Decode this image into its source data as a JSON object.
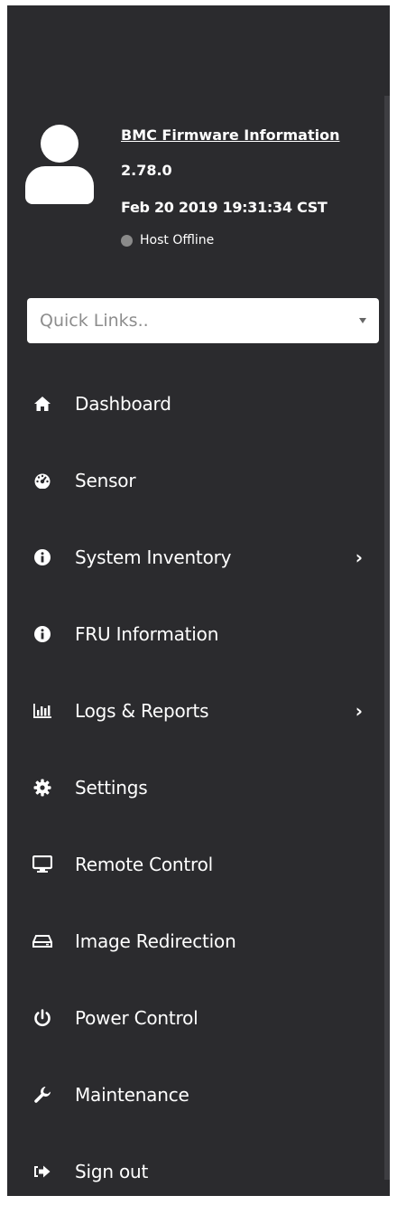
{
  "profile": {
    "firmware_link": "BMC Firmware Information",
    "version": "2.78.0",
    "build_date": "Feb 20 2019 19:31:34 CST",
    "host_status": "Host Offline",
    "host_status_color": "#8a8a8a"
  },
  "quick_links": {
    "placeholder": "Quick Links.."
  },
  "nav": {
    "items": [
      {
        "label": "Dashboard",
        "icon": "home-icon"
      },
      {
        "label": "Sensor",
        "icon": "gauge-icon"
      },
      {
        "label": "System Inventory",
        "icon": "info-icon",
        "has_submenu": true
      },
      {
        "label": "FRU Information",
        "icon": "info-icon"
      },
      {
        "label": "Logs & Reports",
        "icon": "bar-chart-icon",
        "has_submenu": true
      },
      {
        "label": "Settings",
        "icon": "gear-icon"
      },
      {
        "label": "Remote Control",
        "icon": "monitor-icon"
      },
      {
        "label": "Image Redirection",
        "icon": "drive-icon"
      },
      {
        "label": "Power Control",
        "icon": "power-icon"
      },
      {
        "label": "Maintenance",
        "icon": "wrench-icon"
      },
      {
        "label": "Sign out",
        "icon": "sign-out-icon"
      }
    ]
  },
  "colors": {
    "sidebar_bg": "#2b2b2e",
    "text": "#ffffff",
    "placeholder": "#8d8d8d"
  }
}
